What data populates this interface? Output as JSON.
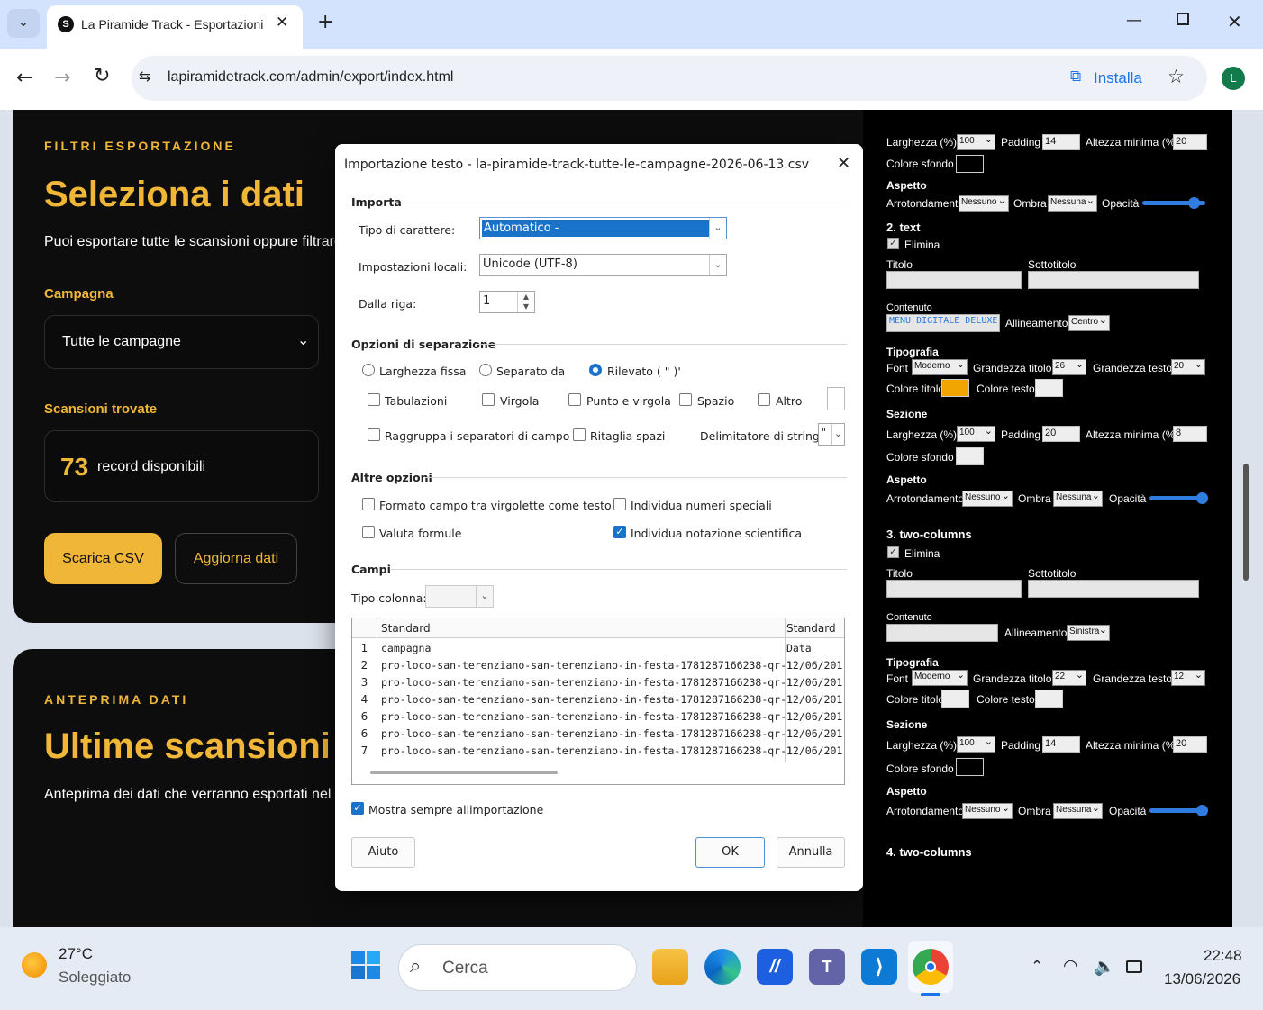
{
  "browser": {
    "tab_title": "La Piramide Track - Esportazioni",
    "url": "lapiramidetrack.com/admin/export/index.html",
    "install_label": "Installa",
    "profile_initial": "L"
  },
  "page": {
    "filters": {
      "eyebrow": "FILTRI ESPORTAZIONE",
      "title": "Seleziona i dati",
      "description": "Puoi esportare tutte le scansioni oppure filtrare un",
      "campaign_label": "Campagna",
      "campaign_value": "Tutte le campagne",
      "scans_label": "Scansioni trovate",
      "count": "73",
      "count_label": "record disponibili",
      "download_button": "Scarica CSV",
      "refresh_button": "Aggiorna dati"
    },
    "preview": {
      "eyebrow": "ANTEPRIMA DATI",
      "title": "Ultime scansioni",
      "description": "Anteprima dei dati che verranno esportati nel file CS"
    }
  },
  "dialog": {
    "title": "Importazione testo - la-piramide-track-tutte-le-campagne-2026-06-13.csv",
    "import_section": "Importa",
    "charset_label": "Tipo di carattere:",
    "charset_value": "Automatico -",
    "locale_label": "Impostazioni locali:",
    "locale_value": "Unicode (UTF-8)",
    "from_row_label": "Dalla riga:",
    "from_row_value": "1",
    "sep_section": "Opzioni di separazione",
    "fixed_width": "Larghezza fissa",
    "separated_by": "Separato da",
    "detected": "Rilevato ( \" )'",
    "tab": "Tabulazioni",
    "comma": "Virgola",
    "semicolon": "Punto e virgola",
    "space": "Spazio",
    "other": "Altro",
    "merge_delim": "Raggruppa i separatori di campo",
    "trim_spaces": "Ritaglia spazi",
    "string_delim_label": "Delimitatore di stringa:",
    "string_delim_value": "\"",
    "other_section": "Altre opzioni",
    "quoted_as_text": "Formato campo tra virgolette come testo",
    "detect_special": "Individua numeri speciali",
    "eval_formulas": "Valuta formule",
    "detect_scientific": "Individua notazione scientifica",
    "fields_section": "Campi",
    "col_type_label": "Tipo colonna:",
    "grid": {
      "headers": [
        "Standard",
        "Standard"
      ],
      "rows": [
        {
          "n": "1",
          "a": "campagna",
          "b": "Data"
        },
        {
          "n": "2",
          "a": "pro-loco-san-terenziano-san-terenziano-in-festa-1781287166238-qr-1",
          "b": "12/06/201"
        },
        {
          "n": "3",
          "a": "pro-loco-san-terenziano-san-terenziano-in-festa-1781287166238-qr-1",
          "b": "12/06/201"
        },
        {
          "n": "4",
          "a": "pro-loco-san-terenziano-san-terenziano-in-festa-1781287166238-qr-1",
          "b": "12/06/201"
        },
        {
          "n": "6",
          "a": "pro-loco-san-terenziano-san-terenziano-in-festa-1781287166238-qr-1",
          "b": "12/06/201"
        },
        {
          "n": "6",
          "a": "pro-loco-san-terenziano-san-terenziano-in-festa-1781287166238-qr-1",
          "b": "12/06/201"
        },
        {
          "n": "7",
          "a": "pro-loco-san-terenziano-san-terenziano-in-festa-1781287166238-qr-1",
          "b": "12/06/201"
        }
      ]
    },
    "always_show": "Mostra sempre allimportazione",
    "help_button": "Aiuto",
    "ok_button": "OK",
    "cancel_button": "Annulla"
  },
  "panel": {
    "width_label": "Larghezza (%)",
    "padding_label": "Padding",
    "min_height_label": "Altezza minima (%)",
    "bg_color_label": "Colore sfondo",
    "appearance_label": "Aspetto",
    "rounding_label": "Arrotondamento",
    "shadow_label": "Ombra",
    "opacity_label": "Opacità",
    "delete_label": "Elimina",
    "title_label": "Titolo",
    "subtitle_label": "Sottotitolo",
    "content_label": "Contenuto",
    "align_label": "Allineamento",
    "typography_label": "Tipografia",
    "font_label": "Font",
    "title_size_label": "Grandezza titolo",
    "text_size_label": "Grandezza testo",
    "title_color_label": "Colore titolo",
    "text_color_label": "Colore testo",
    "section_label": "Sezione",
    "none": "Nessuno",
    "none_f": "Nessuna",
    "modern": "Moderno",
    "top": {
      "width": "100",
      "padding": "14",
      "min_height": "20"
    },
    "block2": {
      "heading": "2. text",
      "content": "MENU DIGITALE DELUXE",
      "align": "Centro",
      "title_size": "26",
      "text_size": "20",
      "title_color": "#f0a500",
      "sec_width": "100",
      "sec_padding": "20",
      "sec_min_height": "8"
    },
    "block3": {
      "heading": "3. two-columns",
      "align": "Sinistra",
      "title_size": "22",
      "text_size": "12",
      "sec_width": "100",
      "sec_padding": "14",
      "sec_min_height": "20"
    },
    "block4": {
      "heading": "4. two-columns"
    }
  },
  "taskbar": {
    "temperature": "27°C",
    "weather": "Soleggiato",
    "search_placeholder": "Cerca",
    "time": "22:48",
    "date": "13/06/2026"
  }
}
